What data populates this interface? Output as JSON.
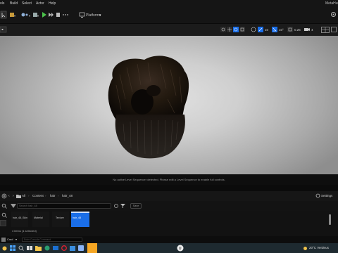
{
  "menubar": {
    "items": [
      "ols",
      "Build",
      "Select",
      "Actor",
      "Help"
    ],
    "right_label": "MetaHum"
  },
  "toolbar": {
    "platforms_label": "Platforms"
  },
  "viewport_toolbar": {
    "grid_value": "10",
    "angle_value": "10°",
    "scale_value": "0.25",
    "camera_value": "4"
  },
  "sequencer": {
    "message": "No active Level Sequencer detected. Please edit a Level Sequence to enable full controls."
  },
  "content_browser": {
    "breadcrumb": [
      "All",
      "Content",
      "hair",
      "hair_48"
    ],
    "settings_label": "Settings",
    "search_placeholder": "Search hair_48",
    "save_label": "Save",
    "assets": [
      {
        "label": "hair_48_Skin",
        "selected": false
      },
      {
        "label": "Material",
        "selected": false
      },
      {
        "label": "Texture",
        "selected": false
      },
      {
        "label": "hair_48",
        "selected": true
      }
    ],
    "status": "4 items (1 selected)"
  },
  "statusbar": {
    "cmd_label": "Cmd",
    "console_placeholder": "Enter Console Command"
  },
  "taskbar": {
    "weather": "20°C Verdeus",
    "accent_color": "#f5a623"
  },
  "colors": {
    "accent_blue": "#1a6ee8",
    "play_green": "#4bc24b",
    "panel_bg": "#151515"
  }
}
